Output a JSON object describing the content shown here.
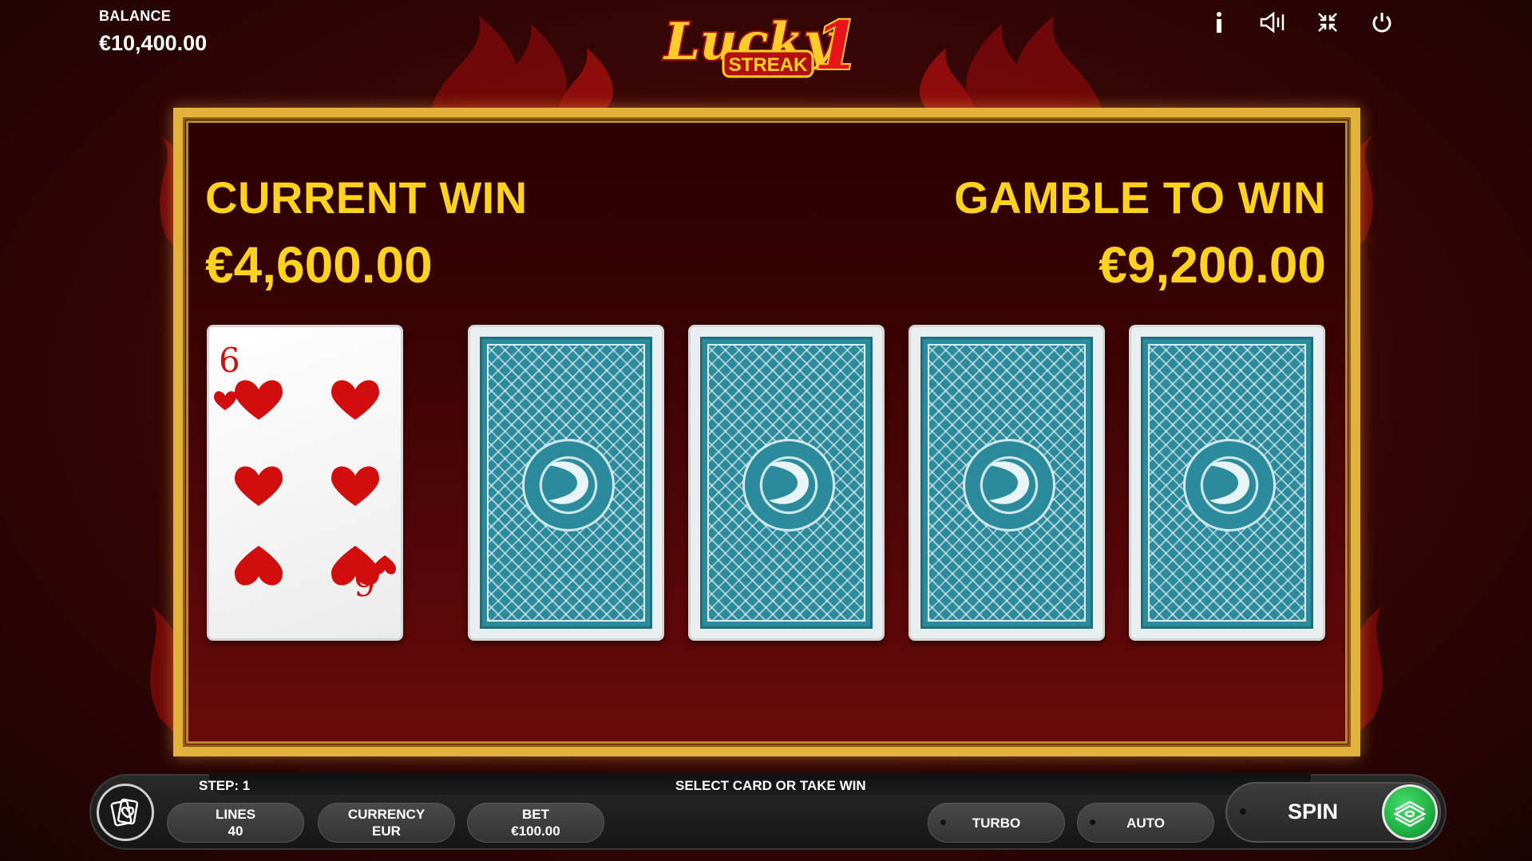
{
  "balance": {
    "label": "BALANCE",
    "value": "€10,400.00"
  },
  "logo": {
    "text_main": "Lucky",
    "text_number": "1",
    "text_sub": "STREAK"
  },
  "top_icons": [
    "info-icon",
    "sound-icon",
    "minimize-icon",
    "power-icon"
  ],
  "gamble": {
    "current_win_label": "CURRENT WIN",
    "current_win_value": "€4,600.00",
    "gamble_to_win_label": "GAMBLE TO WIN",
    "gamble_to_win_value": "€9,200.00",
    "dealer_card": {
      "rank": "6",
      "suit": "hearts"
    },
    "hidden_cards": 4
  },
  "bottom": {
    "step": "STEP: 1",
    "status": "SELECT CARD OR TAKE WIN",
    "lines_label": "LINES",
    "lines_value": "40",
    "currency_label": "CURRENCY",
    "currency_value": "EUR",
    "bet_label": "BET",
    "bet_value": "€100.00",
    "turbo_label": "TURBO",
    "auto_label": "AUTO",
    "spin_label": "SPIN"
  },
  "colors": {
    "accent_gold": "#ffd21f",
    "frame_gold": "#e3b23c",
    "card_back": "#2b8a9b",
    "spin_green": "#1fae42",
    "heart_red": "#d10d0d"
  }
}
